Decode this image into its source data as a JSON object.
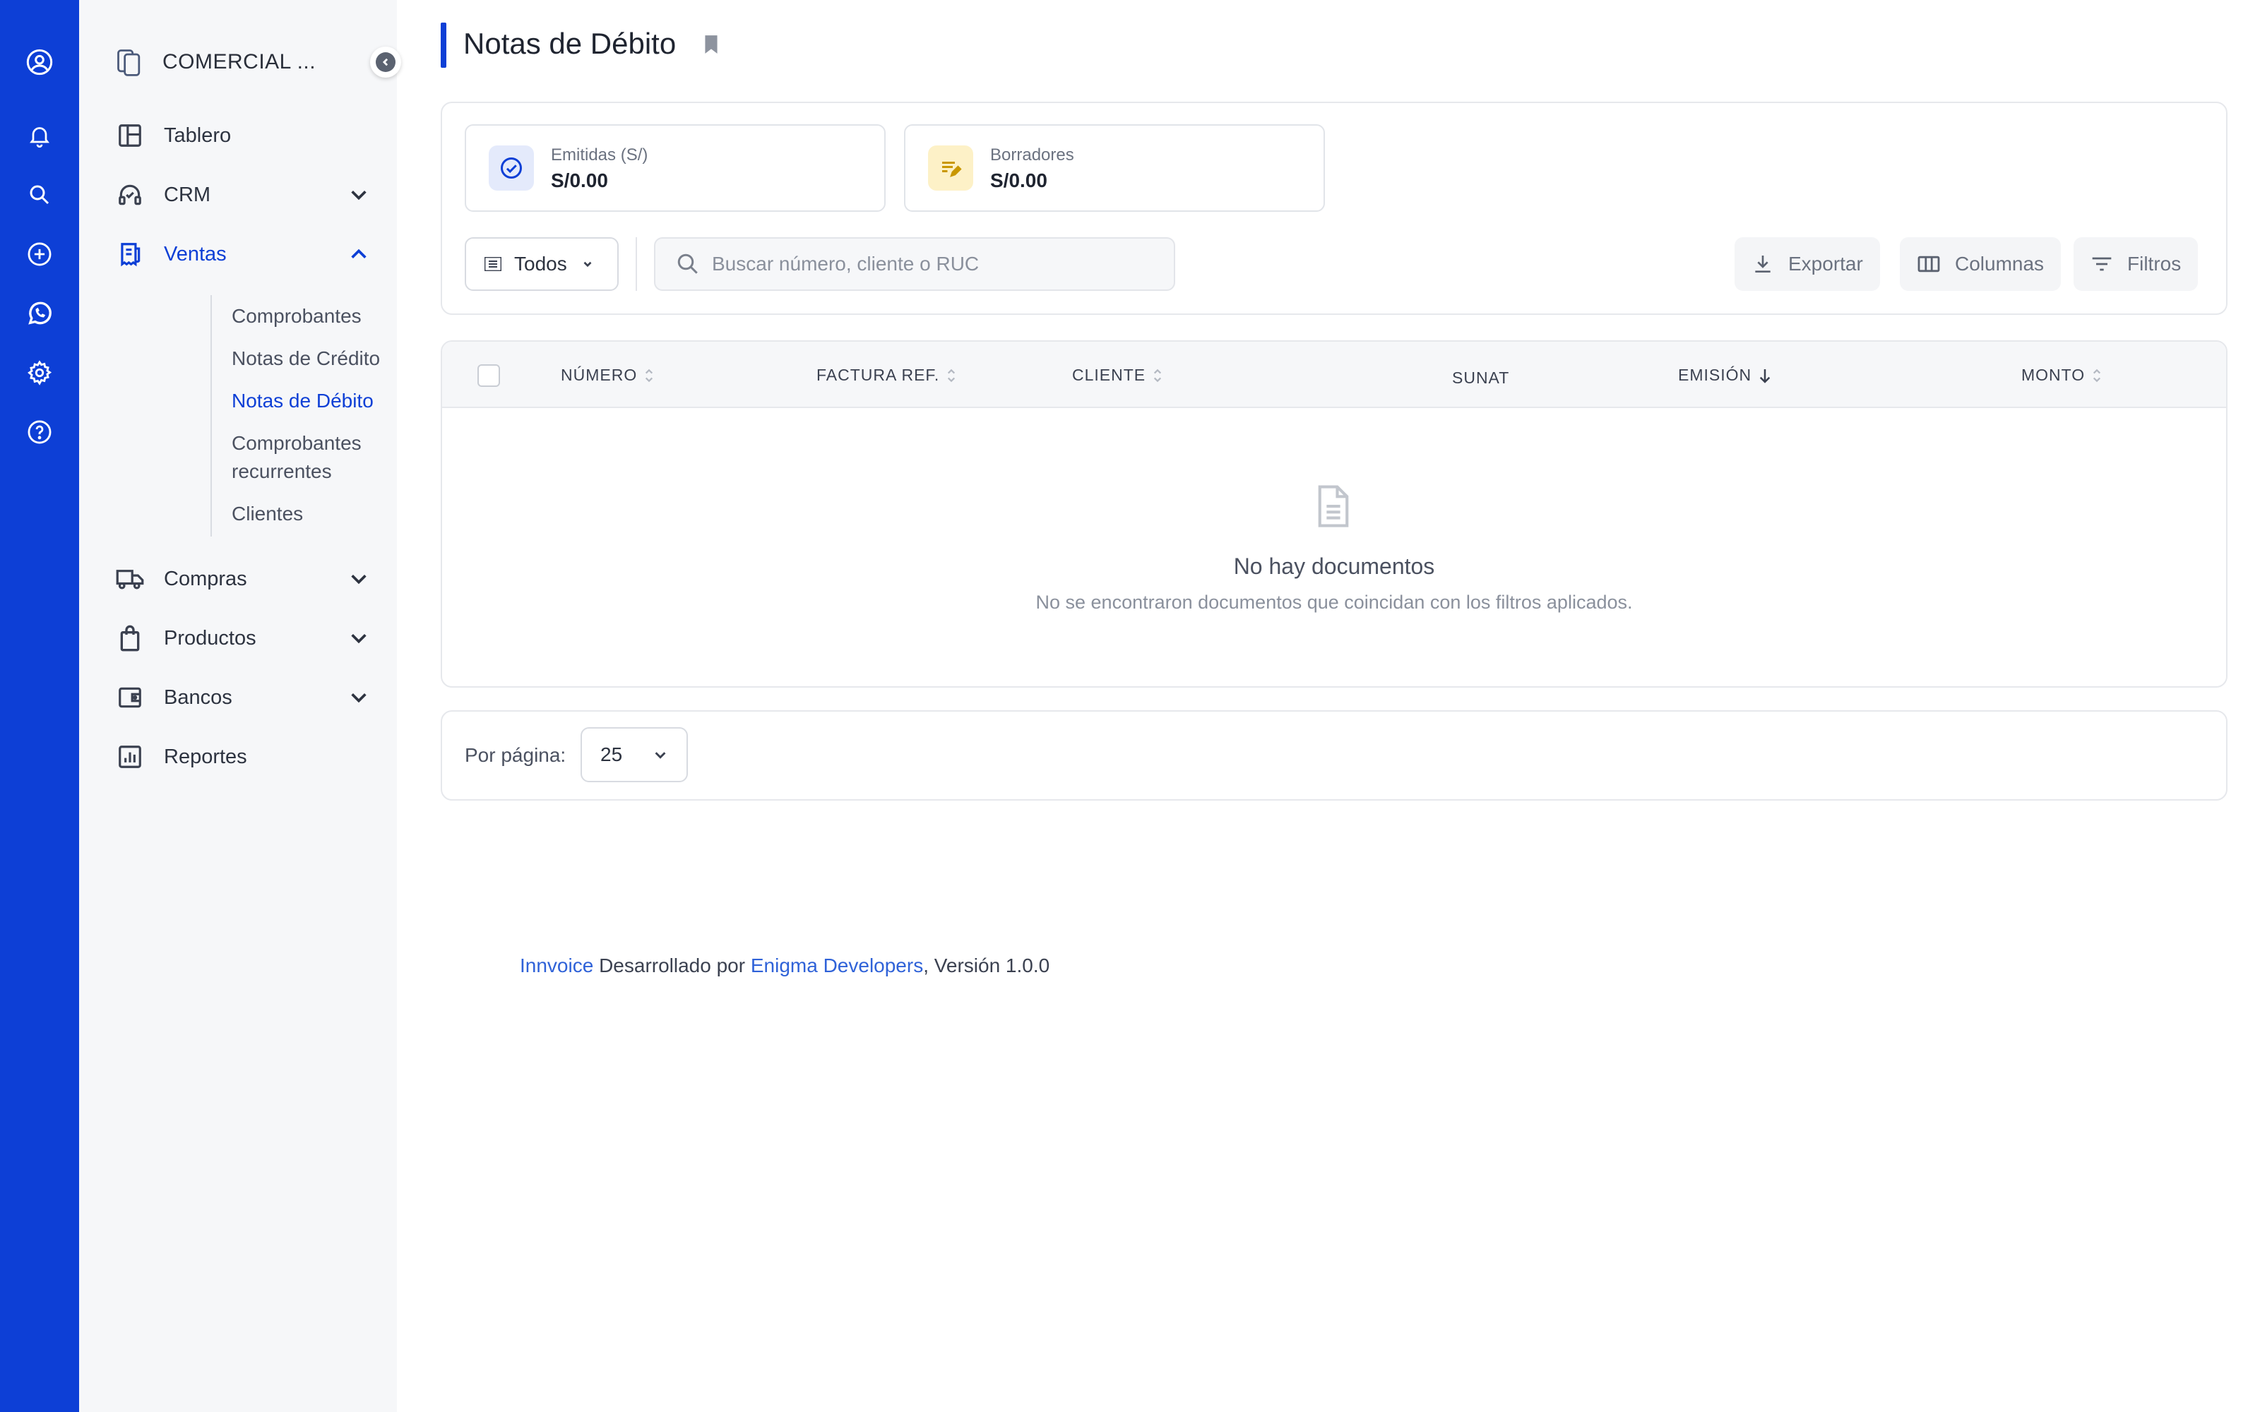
{
  "rail": {
    "icons": [
      "user-circle-icon",
      "bell-icon",
      "search-icon",
      "plus-circle-icon",
      "whatsapp-icon",
      "gear-icon",
      "help-circle-icon"
    ]
  },
  "sidebar": {
    "company": "COMERCIAL ...",
    "items": {
      "tablero": "Tablero",
      "crm": "CRM",
      "ventas": "Ventas",
      "compras": "Compras",
      "productos": "Productos",
      "bancos": "Bancos",
      "reportes": "Reportes"
    },
    "ventas_sub": {
      "comprobantes": "Comprobantes",
      "notas_credito": "Notas de Crédito",
      "notas_debito": "Notas de Débito",
      "recurrentes_1": "Comprobantes",
      "recurrentes_2": "recurrentes",
      "clientes": "Clientes"
    }
  },
  "page": {
    "title": "Notas de Débito"
  },
  "stats": {
    "emitidas": {
      "label": "Emitidas (S/)",
      "value": "S/0.00"
    },
    "borradores": {
      "label": "Borradores",
      "value": "S/0.00"
    }
  },
  "toolbar": {
    "filter_select": "Todos",
    "search_placeholder": "Buscar número, cliente o RUC",
    "export": "Exportar",
    "columns": "Columnas",
    "filters": "Filtros"
  },
  "table": {
    "columns": {
      "numero": "NÚMERO",
      "factura_ref": "FACTURA REF.",
      "cliente": "CLIENTE",
      "sunat": "SUNAT",
      "emision": "EMISIÓN",
      "monto": "MONTO"
    },
    "empty_title": "No hay documentos",
    "empty_subtitle": "No se encontraron documentos que coincidan con los filtros aplicados."
  },
  "pagination": {
    "label": "Por página:",
    "value": "25"
  },
  "footer": {
    "brand": "Innvoice",
    "text1": " Desarrollado por ",
    "company": "Enigma Developers",
    "text2": ", Versión 1.0.0"
  },
  "colors": {
    "primary": "#0d3fd6",
    "sidebar_bg": "#f6f7f9",
    "link": "#2f62d8"
  }
}
